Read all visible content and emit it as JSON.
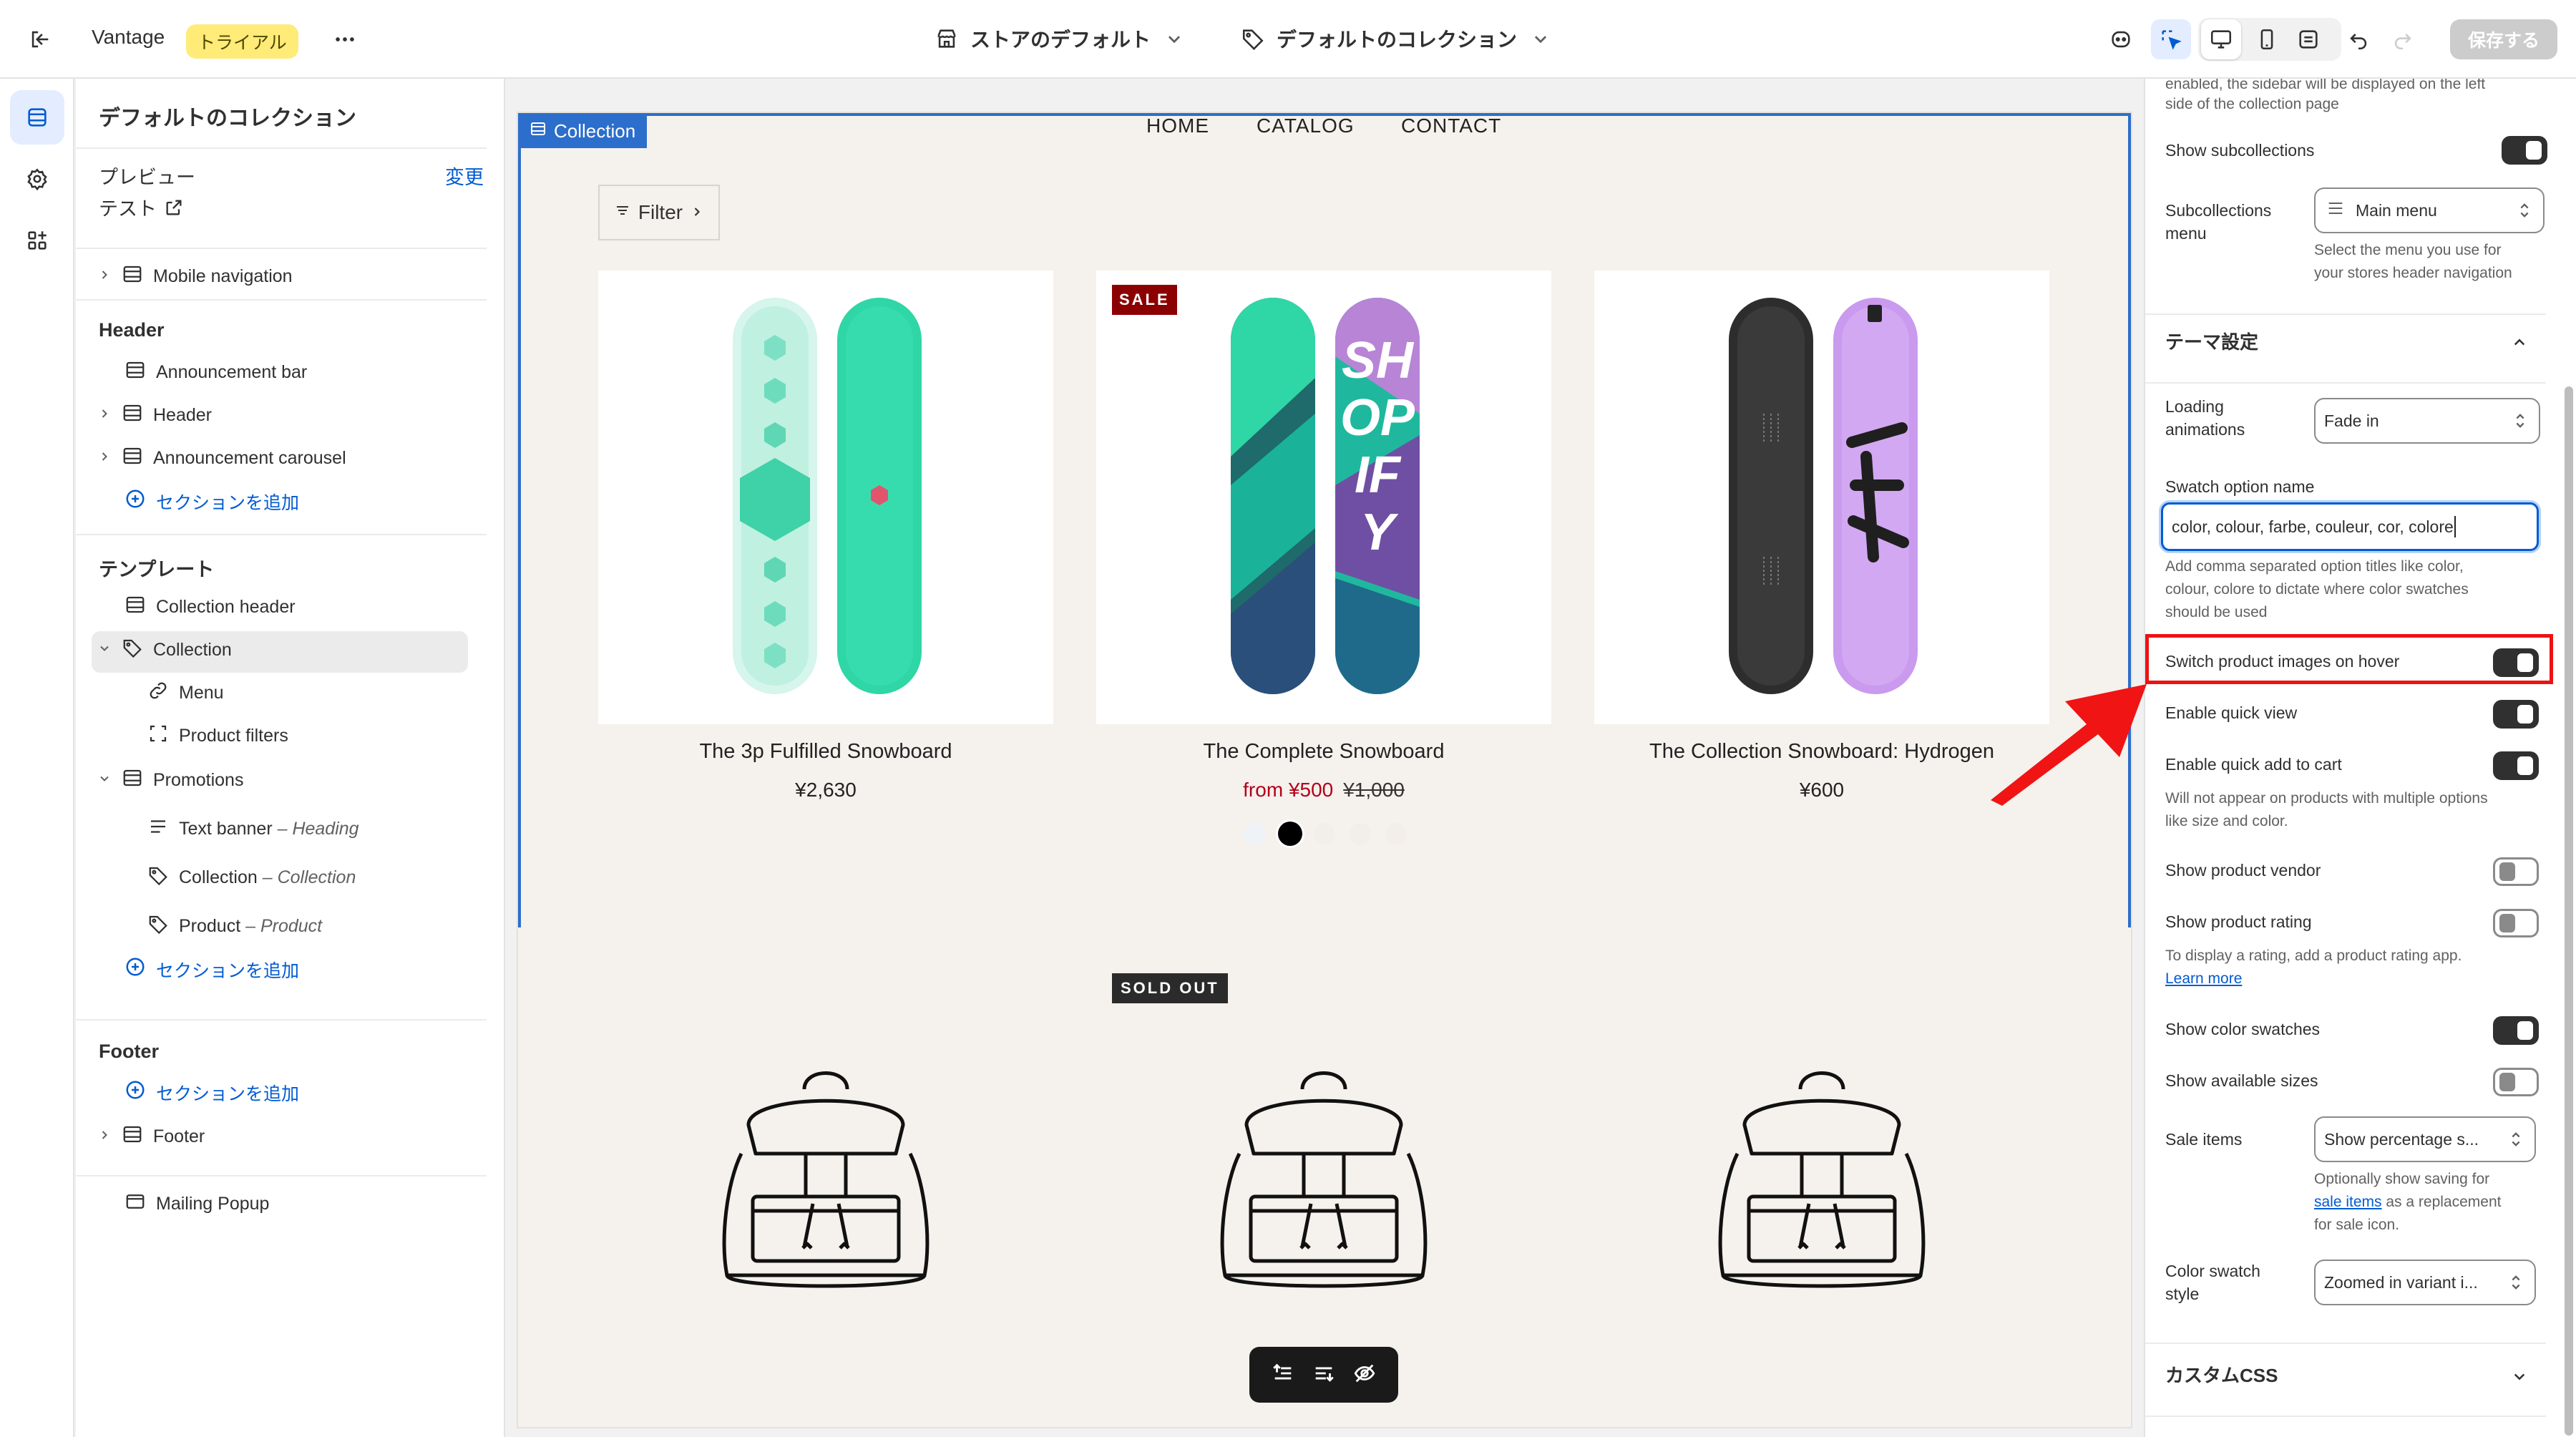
{
  "topbar": {
    "app_name": "Vantage",
    "badge": "トライアル",
    "store_context": "ストアのデフォルト",
    "template_context": "デフォルトのコレクション",
    "save_label": "保存する"
  },
  "left_panel": {
    "title": "デフォルトのコレクション",
    "preview_label": "プレビュー",
    "preview_change": "変更",
    "preview_value": "テスト",
    "items": {
      "mobile_nav": "Mobile navigation",
      "header_section": "Header",
      "announcement_bar": "Announcement bar",
      "header": "Header",
      "announcement_carousel": "Announcement carousel",
      "add_section": "セクションを追加",
      "template_section": "テンプレート",
      "collection_header": "Collection header",
      "collection": "Collection",
      "menu": "Menu",
      "product_filters": "Product filters",
      "promotions": "Promotions",
      "text_banner": "Text banner",
      "text_banner_sub": "– Heading",
      "collection_block": "Collection",
      "collection_block_sub": "– Collection",
      "product_block": "Product",
      "product_block_sub": "– Product",
      "add_section_2": "セクションを追加",
      "footer_section": "Footer",
      "add_section_3": "セクションを追加",
      "footer": "Footer",
      "mailing_popup": "Mailing Popup"
    }
  },
  "preview": {
    "selected_label": "Collection",
    "nav": [
      "HOME",
      "CATALOG",
      "CONTACT"
    ],
    "filter_label": "Filter",
    "products": [
      {
        "title": "The 3p Fulfilled Snowboard",
        "price": "¥2,630"
      },
      {
        "title": "The Complete Snowboard",
        "price": "from ¥500",
        "compare_price": "¥1,000",
        "badge": "SALE"
      },
      {
        "title": "The Collection Snowboard: Hydrogen",
        "price": "¥600"
      }
    ],
    "soldout_badge": "SOLD OUT"
  },
  "right_panel": {
    "top_help_1": "enabled, the sidebar will be displayed on the left",
    "top_help_2": "side of the collection page",
    "show_subcollections": "Show subcollections",
    "subcollections_menu_1": "Subcollections",
    "subcollections_menu_2": "menu",
    "subcollections_menu_value": "Main menu",
    "subcollections_help_1": "Select the menu you use for",
    "subcollections_help_2": "your stores header navigation",
    "theme_settings": "テーマ設定",
    "loading_animations_1": "Loading",
    "loading_animations_2": "animations",
    "loading_animations_value": "Fade in",
    "swatch_option_name": "Swatch option name",
    "swatch_option_value": "color, colour, farbe, couleur, cor, colore",
    "swatch_help_1": "Add comma separated option titles like color,",
    "swatch_help_2": "colour, colore to dictate where color swatches",
    "swatch_help_3": "should be used",
    "switch_images_hover": "Switch product images on hover",
    "enable_quick_view": "Enable quick view",
    "enable_quick_add": "Enable quick add to cart",
    "quick_add_help_1": "Will not appear on products with multiple options",
    "quick_add_help_2": "like size and color.",
    "show_vendor": "Show product vendor",
    "show_rating": "Show product rating",
    "rating_help": "To display a rating, add a product rating app.",
    "learn_more": "Learn more",
    "show_color_swatches": "Show color swatches",
    "show_available_sizes": "Show available sizes",
    "sale_items": "Sale items",
    "sale_items_value": "Show percentage s...",
    "sale_help_1": "Optionally show saving for",
    "sale_help_link": "sale items",
    "sale_help_2": "as a replacement",
    "sale_help_3": "for sale icon.",
    "color_swatch_style_1": "Color swatch",
    "color_swatch_style_2": "style",
    "color_swatch_style_value": "Zoomed in variant i...",
    "custom_css": "カスタムCSS"
  },
  "toggles": {
    "show_subcollections": true,
    "switch_images_hover": true,
    "enable_quick_view": true,
    "enable_quick_add": true,
    "show_vendor": false,
    "show_rating": false,
    "show_color_swatches": true,
    "show_available_sizes": false
  },
  "colors": {
    "accent": "#005bd3",
    "selection": "#2c6ecb",
    "highlight": "#ee1111",
    "sale": "#8b0000",
    "arrow": "#f01414"
  },
  "icons": [
    "exit-icon",
    "more-icon",
    "store-icon",
    "tag-icon",
    "chevron-down-icon",
    "inspect-icon",
    "desktop-icon",
    "mobile-icon",
    "fullwidth-icon",
    "undo-icon",
    "redo-icon",
    "sections-icon",
    "settings-icon",
    "apps-icon",
    "external-link-icon",
    "section-icon",
    "plus-circle-icon",
    "link-icon",
    "filter-icon",
    "filter-lines-icon",
    "chevron-right-icon",
    "menu-lines-icon",
    "select-arrows-icon",
    "chevron-up-icon"
  ]
}
